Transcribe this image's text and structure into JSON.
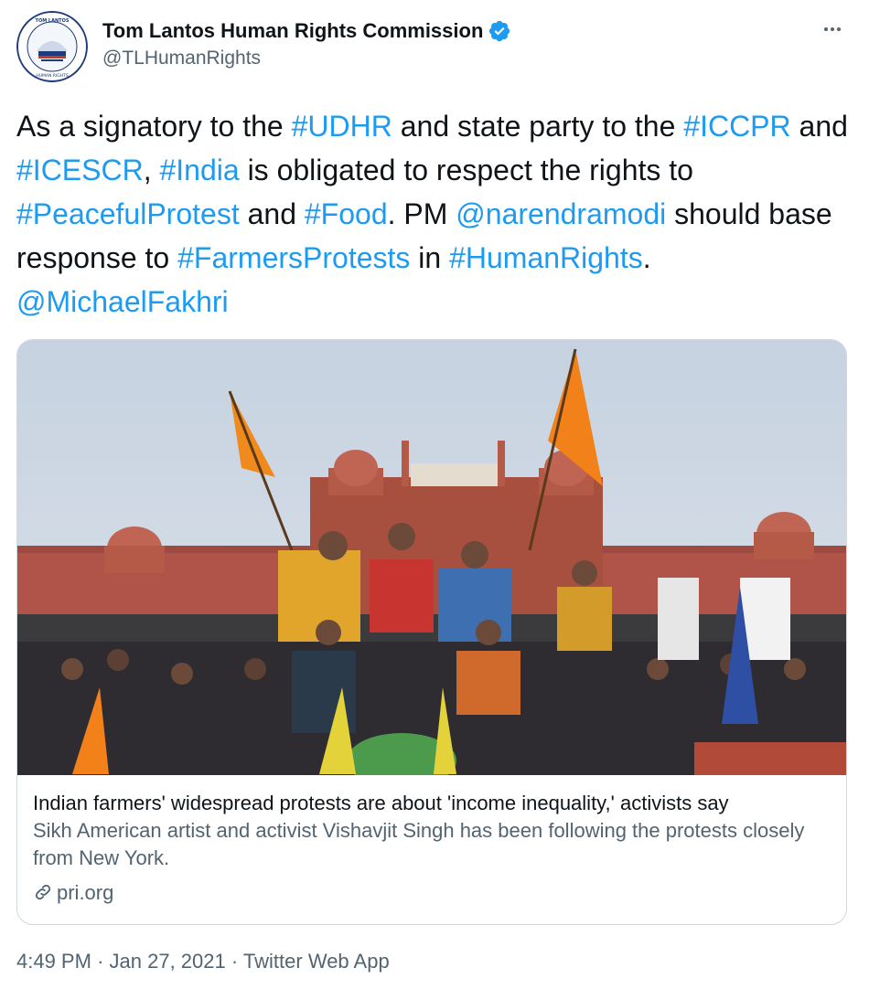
{
  "account": {
    "display_name": "Tom Lantos Human Rights Commission",
    "handle": "@TLHumanRights",
    "verified_icon": "verified-badge-icon",
    "avatar_seal_text": "TOM LANTOS HUMAN RIGHTS COMMISSION"
  },
  "tweet": {
    "segments": [
      {
        "text": "As a signatory to the ",
        "link": false
      },
      {
        "text": "#UDHR",
        "link": true
      },
      {
        "text": " and state party to the ",
        "link": false
      },
      {
        "text": "#ICCPR",
        "link": true
      },
      {
        "text": " and ",
        "link": false
      },
      {
        "text": "#ICESCR",
        "link": true
      },
      {
        "text": ", ",
        "link": false
      },
      {
        "text": "#India",
        "link": true
      },
      {
        "text": " is obligated to respect the rights to ",
        "link": false
      },
      {
        "text": "#PeacefulProtest",
        "link": true
      },
      {
        "text": " and ",
        "link": false
      },
      {
        "text": "#Food",
        "link": true
      },
      {
        "text": ". PM ",
        "link": false
      },
      {
        "text": "@narendramodi",
        "link": true
      },
      {
        "text": "  should base response to ",
        "link": false
      },
      {
        "text": "#FarmersProtests",
        "link": true
      },
      {
        "text": " in ",
        "link": false
      },
      {
        "text": "#HumanRights",
        "link": true
      },
      {
        "text": ". ",
        "link": false
      },
      {
        "text": "@MichaelFakhri",
        "link": true
      }
    ]
  },
  "card": {
    "title": "Indian farmers' widespread protests are about 'income inequality,' activists say",
    "description": "Sikh American artist and activist Vishavjit Singh has been following the protests closely from New York.",
    "domain": "pri.org"
  },
  "meta": {
    "time": "4:49 PM",
    "date": "Jan 27, 2021",
    "source": "Twitter Web App",
    "separator": "·"
  },
  "colors": {
    "link": "#1d9bf0",
    "text": "#0f1419",
    "secondary": "#536471",
    "border": "#cfd9de"
  },
  "icons": [
    "verified-badge-icon",
    "more-options-icon",
    "link-icon"
  ]
}
